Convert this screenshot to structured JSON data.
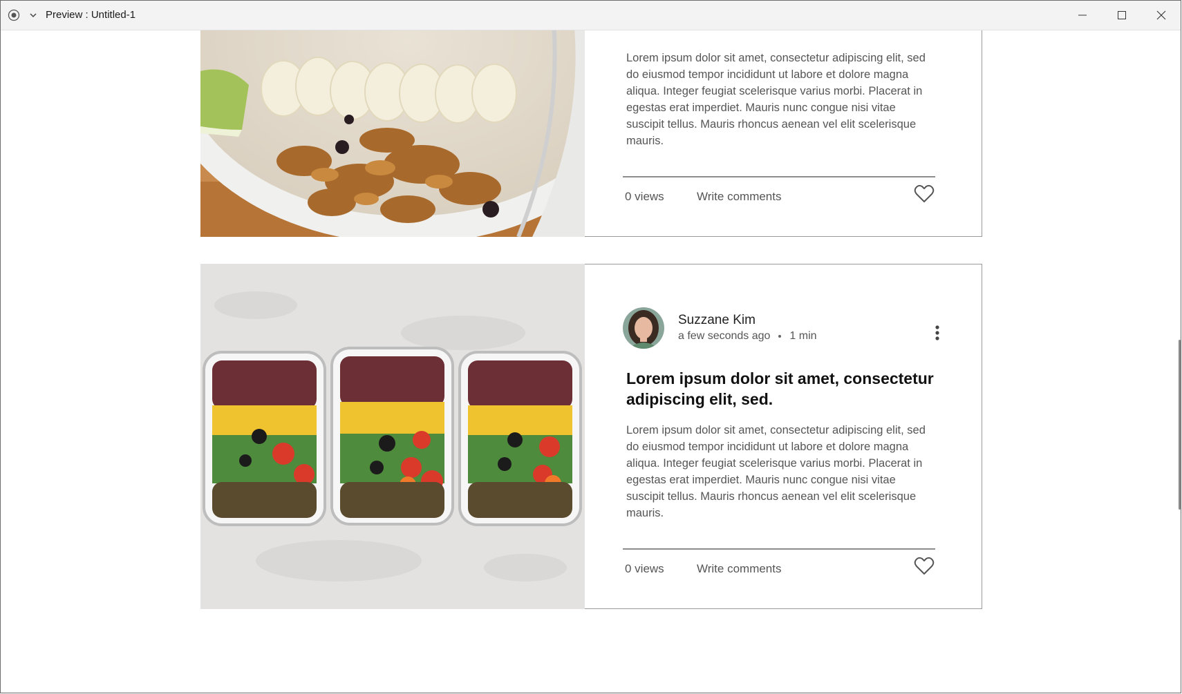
{
  "window": {
    "title": "Preview : Untitled-1"
  },
  "icons": {
    "app": "record-icon",
    "dropdown": "chevron-down-icon",
    "minimize": "minimize-icon",
    "maximize": "maximize-icon",
    "close": "close-icon",
    "more": "more-vertical-icon",
    "like": "heart-icon"
  },
  "posts": [
    {
      "image": "granola-bowl-photo",
      "excerpt": "Lorem ipsum dolor sit amet, consectetur adipiscing elit, sed do eiusmod tempor incididunt ut labore et dolore magna aliqua. Integer feugiat scelerisque varius morbi. Placerat in egestas erat imperdiet. Mauris nunc congue nisi vitae suscipit tellus. Mauris rhoncus aenean vel elit scelerisque mauris.",
      "views": "0 views",
      "comments": "Write comments"
    },
    {
      "image": "meal-prep-containers-photo",
      "author": "Suzzane Kim",
      "time": "a few seconds ago",
      "read_time": "1 min",
      "title": "Lorem ipsum dolor sit amet, consectetur adipiscing elit, sed.",
      "excerpt": "Lorem ipsum dolor sit amet, consectetur adipiscing elit, sed do eiusmod tempor incididunt ut labore et dolore magna aliqua. Integer feugiat scelerisque varius morbi. Placerat in egestas erat imperdiet. Mauris nunc congue nisi vitae suscipit tellus. Mauris rhoncus aenean vel elit scelerisque mauris.",
      "views": "0 views",
      "comments": "Write comments"
    }
  ],
  "colors": {
    "titlebar": "#f3f3f3",
    "border": "#9a9a9a",
    "text_muted": "#555555"
  }
}
